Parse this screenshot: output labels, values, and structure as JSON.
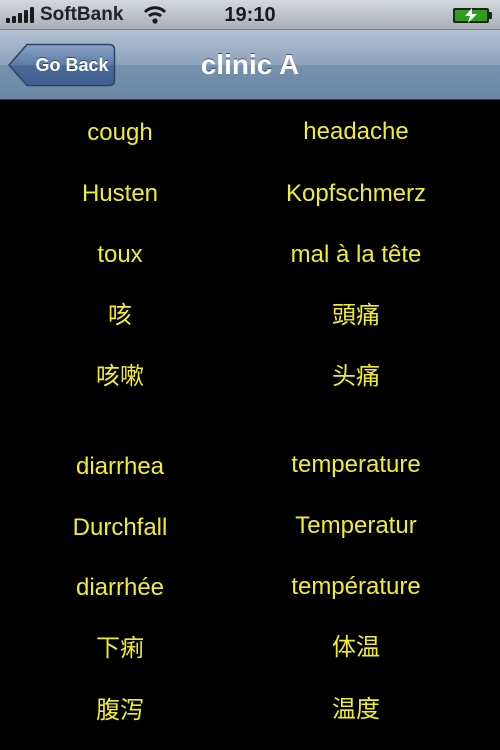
{
  "status_bar": {
    "carrier": "SoftBank",
    "time": "19:10",
    "battery_status": "charging",
    "icons": [
      "signal-icon",
      "wifi-icon",
      "battery-icon",
      "charging-bolt-icon"
    ]
  },
  "nav": {
    "back_label": "Go Back",
    "title": "clinic A"
  },
  "colors": {
    "text": "#f2ed2c",
    "background": "#000000",
    "nav_bar": "#7690b0"
  },
  "groups": [
    {
      "left": [
        "cough",
        "Husten",
        "toux",
        "咳",
        "咳嗽"
      ],
      "right": [
        "headache",
        "Kopfschmerz",
        "mal à la tête",
        "頭痛",
        "头痛"
      ]
    },
    {
      "left": [
        "diarrhea",
        "Durchfall",
        "diarrhée",
        "下痢",
        "腹泻"
      ],
      "right": [
        "temperature",
        "Temperatur",
        "température",
        "体温",
        "温度"
      ]
    }
  ]
}
